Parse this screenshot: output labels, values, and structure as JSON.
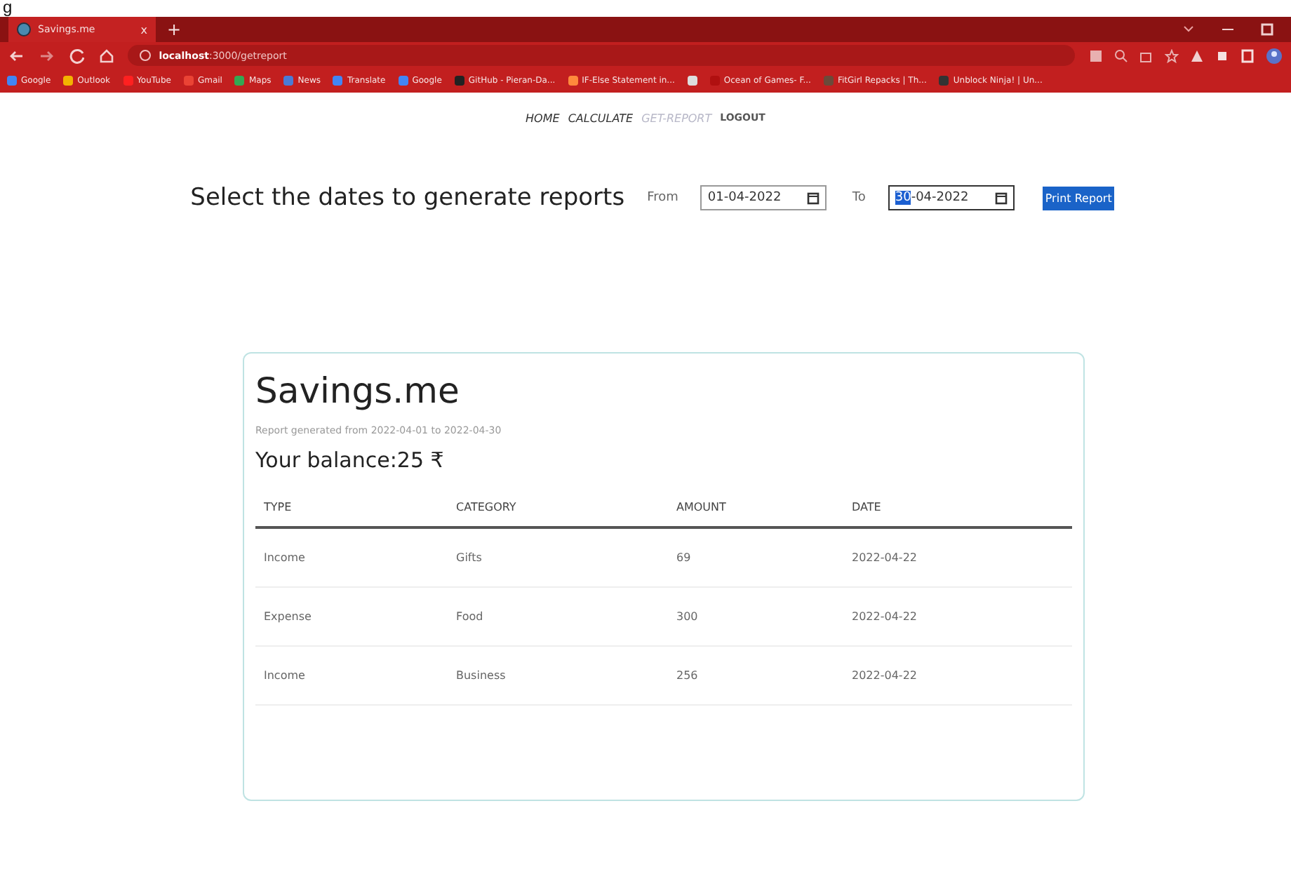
{
  "stray_text": "g",
  "browser": {
    "tab": {
      "title": "Savings.me",
      "close": "x"
    },
    "new_tab": "+",
    "url_host": "localhost",
    "url_path": ":3000/getreport",
    "bookmarks": [
      {
        "label": "Google",
        "color": "#4285f4"
      },
      {
        "label": "Outlook",
        "color": "#f3b300"
      },
      {
        "label": "YouTube",
        "color": "#ff2020"
      },
      {
        "label": "Gmail",
        "color": "#ea4335"
      },
      {
        "label": "Maps",
        "color": "#34a853"
      },
      {
        "label": "News",
        "color": "#4a7bd6"
      },
      {
        "label": "Translate",
        "color": "#4285f4"
      },
      {
        "label": "Google",
        "color": "#4285f4"
      },
      {
        "label": "GitHub - Pieran-Da...",
        "color": "#222222"
      },
      {
        "label": "IF-Else Statement in...",
        "color": "#ff8a3c"
      },
      {
        "color": "#dddddd"
      },
      {
        "label": "Ocean of Games- F...",
        "color": "#b01010"
      },
      {
        "label": "FitGirl Repacks | Th...",
        "color": "#6b4a3a"
      },
      {
        "label": "Unblock Ninja! | Un...",
        "color": "#333333"
      }
    ]
  },
  "nav": [
    {
      "label": "HOME",
      "selected": false
    },
    {
      "label": "CALCULATE",
      "selected": false
    },
    {
      "label": "GET-REPORT",
      "selected": true
    },
    {
      "label": "LOGOUT",
      "selected": false
    }
  ],
  "form": {
    "heading": "Select the dates to generate reports",
    "from_label": "From",
    "from_value": "01-04-2022",
    "to_label": "To",
    "to_highlight": "30",
    "to_rest": "-04-2022",
    "button": "Print Report"
  },
  "report": {
    "title": "Savings.me",
    "subtitle": "Report generated from 2022-04-01 to 2022-04-30",
    "balance": "Your balance:25 ₹",
    "columns": [
      "TYPE",
      "CATEGORY",
      "AMOUNT",
      "DATE"
    ],
    "rows": [
      [
        "Income",
        "Gifts",
        "69",
        "2022-04-22"
      ],
      [
        "Expense",
        "Food",
        "300",
        "2022-04-22"
      ],
      [
        "Income",
        "Business",
        "256",
        "2022-04-22"
      ]
    ]
  }
}
